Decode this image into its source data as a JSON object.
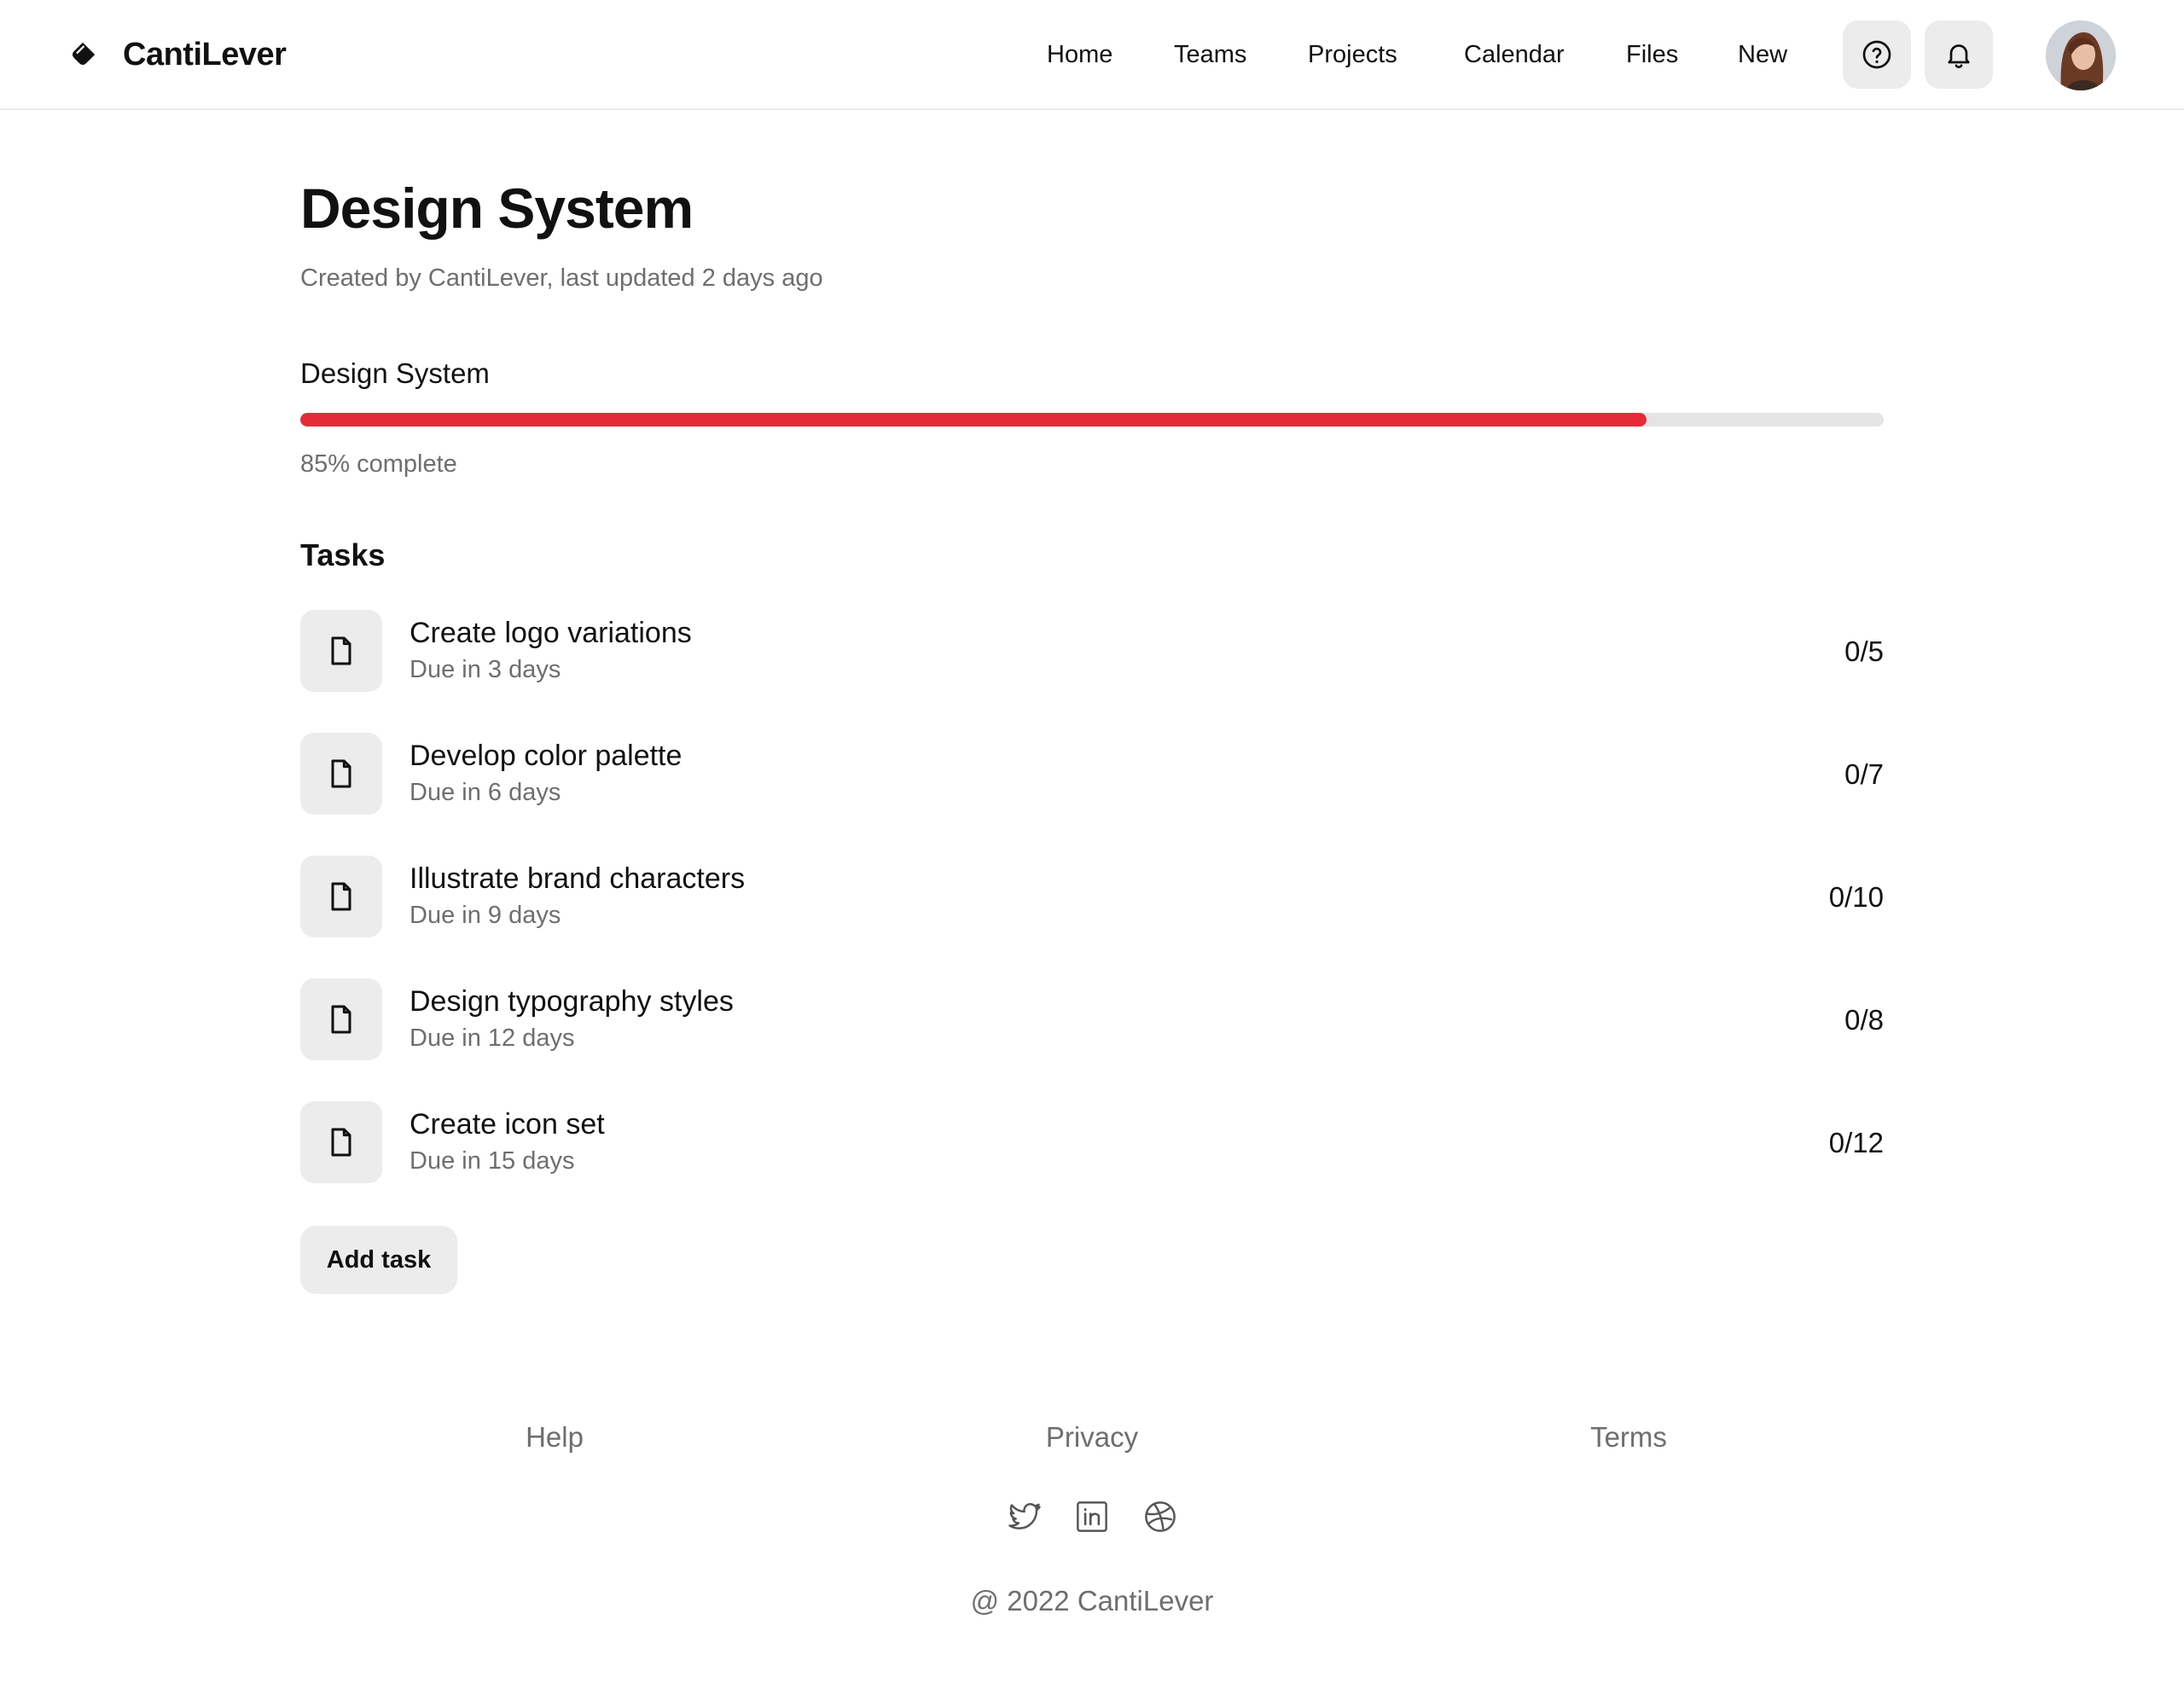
{
  "header": {
    "brand": "CantiLever",
    "nav": [
      {
        "label": "Home"
      },
      {
        "label": "Teams"
      },
      {
        "label": "Projects"
      },
      {
        "label": "Calendar"
      },
      {
        "label": "Files"
      },
      {
        "label": "New"
      }
    ],
    "icons": [
      "help-icon",
      "bell-icon"
    ]
  },
  "page": {
    "title": "Design System",
    "meta": "Created by CantiLever, last updated 2 days ago"
  },
  "progress": {
    "label": "Design System",
    "percent": 85,
    "text": "85% complete",
    "fill_color": "#e52b38"
  },
  "tasks": {
    "heading": "Tasks",
    "items": [
      {
        "title": "Create logo variations",
        "due": "Due in 3 days",
        "count": "0/5"
      },
      {
        "title": "Develop color palette",
        "due": "Due in 6 days",
        "count": "0/7"
      },
      {
        "title": "Illustrate brand characters",
        "due": "Due in 9 days",
        "count": "0/10"
      },
      {
        "title": "Design typography styles",
        "due": "Due in 12 days",
        "count": "0/8"
      },
      {
        "title": "Create icon set",
        "due": "Due in 15 days",
        "count": "0/12"
      }
    ],
    "add_label": "Add task"
  },
  "footer": {
    "links": [
      {
        "label": "Help"
      },
      {
        "label": "Privacy"
      },
      {
        "label": "Terms"
      }
    ],
    "social_icons": [
      "twitter-icon",
      "linkedin-icon",
      "dribbble-icon"
    ],
    "copyright": "@ 2022 CantiLever"
  }
}
